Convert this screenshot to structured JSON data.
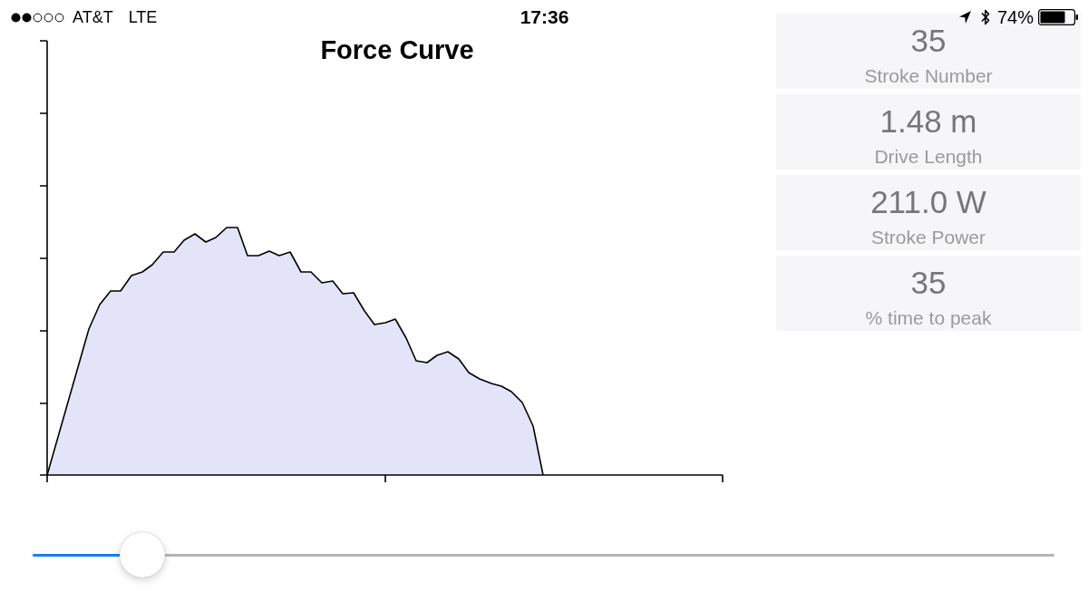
{
  "status_bar": {
    "carrier": "AT&T",
    "network": "LTE",
    "time": "17:36",
    "battery": "74%"
  },
  "chart": {
    "title": "Force Curve"
  },
  "stats": [
    {
      "value": "35",
      "label": "Stroke Number"
    },
    {
      "value": "1.48 m",
      "label": "Drive Length"
    },
    {
      "value": "211.0 W",
      "label": "Stroke Power"
    },
    {
      "value": "35",
      "label": "% time to peak"
    }
  ],
  "slider": {
    "level": 0.107
  }
}
